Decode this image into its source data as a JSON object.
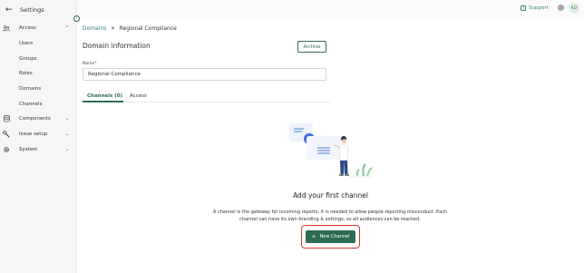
{
  "sidebar": {
    "title": "Settings",
    "sections": [
      {
        "label": "Access",
        "icon": "people-icon",
        "expanded": true,
        "items": [
          "Users",
          "Groups",
          "Roles",
          "Domains",
          "Channels"
        ]
      },
      {
        "label": "Components",
        "icon": "database-icon",
        "expanded": false
      },
      {
        "label": "Issue setup",
        "icon": "wrench-icon",
        "expanded": false
      },
      {
        "label": "System",
        "icon": "gear-icon",
        "expanded": false
      }
    ]
  },
  "topbar": {
    "support_label": "Support",
    "avatar_initials": "KD"
  },
  "breadcrumb": {
    "parent": "Domains",
    "current": "Regional Compliance"
  },
  "domain_info": {
    "title": "Domain information",
    "archive_label": "Archive",
    "name_label": "Name*",
    "name_value": "Regional Compliance"
  },
  "tabs": [
    {
      "label": "Channels (0)",
      "active": true
    },
    {
      "label": "Access",
      "active": false
    }
  ],
  "empty_state": {
    "title": "Add your first channel",
    "description": "A channel is the gateway for incoming reports. It is needed to allow people reporting misconduct. Each channel can have its own branding & settings, so all audiences can be reached.",
    "button_label": "New Channel"
  },
  "colors": {
    "accent": "#2f6b53",
    "link": "#2f7a7a",
    "highlight": "#d9342b"
  }
}
